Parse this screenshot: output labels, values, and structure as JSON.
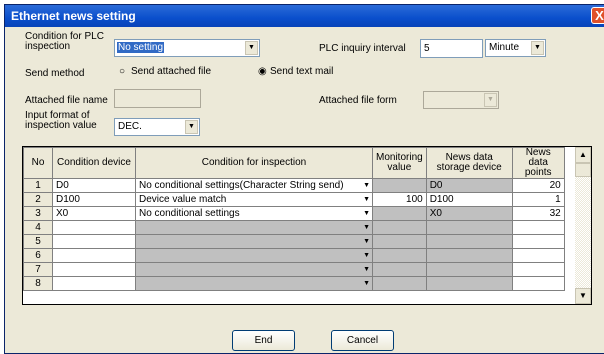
{
  "window": {
    "title": "Ethernet news setting",
    "close_glyph": "X"
  },
  "form": {
    "condition_plc_label": "Condition for PLC inspection",
    "condition_plc_value": "No setting",
    "plc_inquiry_label": "PLC inquiry interval",
    "plc_inquiry_value": "5",
    "plc_inquiry_unit": "Minute",
    "send_method_label": "Send method",
    "send_options": [
      "Send attached file",
      "Send text mail"
    ],
    "send_selected_index": 1,
    "attached_file_name_label": "Attached file name",
    "attached_file_name_value": "",
    "attached_file_form_label": "Attached file form",
    "attached_file_form_value": "",
    "input_format_label": "Input format of inspection value",
    "input_format_value": "DEC."
  },
  "table": {
    "headers": [
      "No",
      "Condition device",
      "Condition for inspection",
      "Monitoring value",
      "News data storage device",
      "News data points"
    ],
    "rows": [
      {
        "no": "1",
        "device": "D0",
        "condition": "No conditional settings(Character String send)",
        "monitoring": "",
        "storage": "D0",
        "points": "20"
      },
      {
        "no": "2",
        "device": "D100",
        "condition": "Device value match",
        "monitoring": "100",
        "storage": "D100",
        "points": "1"
      },
      {
        "no": "3",
        "device": "X0",
        "condition": "No conditional settings",
        "monitoring": "",
        "storage": "X0",
        "points": "32"
      },
      {
        "no": "4",
        "device": "",
        "condition": "",
        "monitoring": "",
        "storage": "",
        "points": ""
      },
      {
        "no": "5",
        "device": "",
        "condition": "",
        "monitoring": "",
        "storage": "",
        "points": ""
      },
      {
        "no": "6",
        "device": "",
        "condition": "",
        "monitoring": "",
        "storage": "",
        "points": ""
      },
      {
        "no": "7",
        "device": "",
        "condition": "",
        "monitoring": "",
        "storage": "",
        "points": ""
      },
      {
        "no": "8",
        "device": "",
        "condition": "",
        "monitoring": "",
        "storage": "",
        "points": ""
      }
    ]
  },
  "buttons": {
    "end": "End",
    "cancel": "Cancel"
  },
  "colors": {
    "title_bar": "#0a4fcc",
    "dialog_bg": "#ece9d8",
    "grey_cell": "#c0c0c0",
    "selection": "#316ac5"
  }
}
